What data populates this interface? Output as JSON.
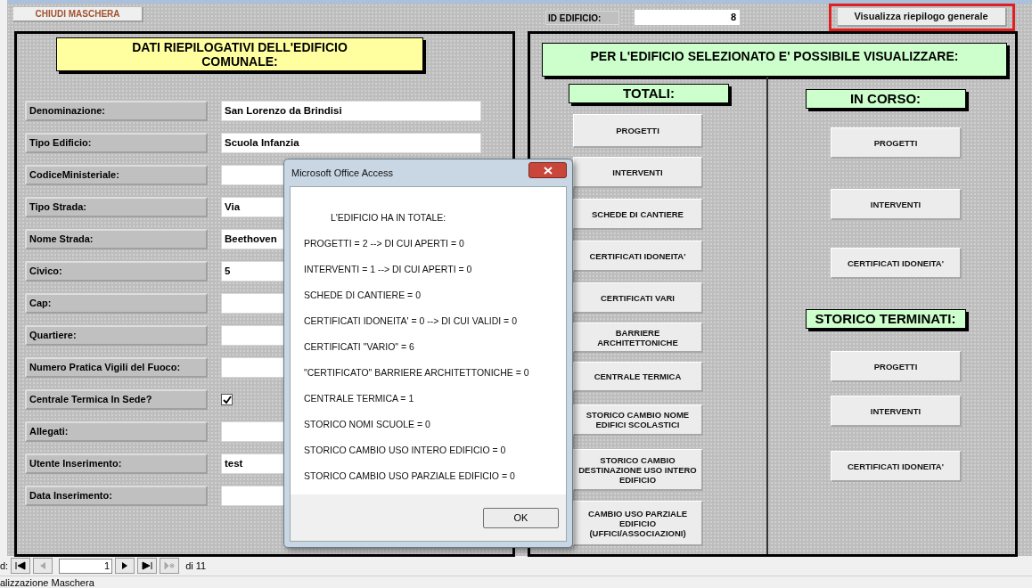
{
  "top_bar": {
    "close_button": "CHIUDI MASCHERA",
    "id_label": "ID EDIFICIO:",
    "id_value": "8",
    "summary_button": {
      "label": "Visualizza riepilogo generale",
      "highlighted": true
    }
  },
  "left_panel": {
    "title": "DATI RIEPILOGATIVI DELL'EDIFICIO COMUNALE:",
    "fields": [
      {
        "label": "Denominazione:",
        "kind": "text",
        "value": "San Lorenzo da Brindisi"
      },
      {
        "label": "Tipo Edificio:",
        "kind": "text",
        "value": "Scuola Infanzia"
      },
      {
        "label": "CodiceMinisteriale:",
        "kind": "text"
      },
      {
        "label": "Tipo Strada:",
        "kind": "text",
        "value": "Via"
      },
      {
        "label": "Nome Strada:",
        "kind": "text",
        "value": "Beethoven"
      },
      {
        "label": "Civico:",
        "kind": "text",
        "value": "5"
      },
      {
        "label": "Cap:",
        "kind": "text"
      },
      {
        "label": "Quartiere:",
        "kind": "text"
      },
      {
        "label": "Numero Pratica Vigili del Fuoco:",
        "kind": "text"
      },
      {
        "label": "Centrale Termica In Sede?",
        "kind": "checkbox",
        "checked": true
      },
      {
        "label": "Allegati:",
        "kind": "text"
      },
      {
        "label": "Utente Inserimento:",
        "kind": "text",
        "value": "test"
      },
      {
        "label": "Data Inserimento:",
        "kind": "text"
      }
    ]
  },
  "right_panel": {
    "title": "PER L'EDIFICIO SELEZIONATO E' POSSIBILE VISUALIZZARE:",
    "totali": {
      "header": "TOTALI:",
      "buttons": [
        "PROGETTI",
        "INTERVENTI",
        "SCHEDE DI CANTIERE",
        "CERTIFICATI IDONEITA'",
        "CERTIFICATI VARI",
        "BARRIERE ARCHITETTONICHE",
        "CENTRALE TERMICA",
        "STORICO CAMBIO NOME EDIFICI SCOLASTICI",
        "STORICO CAMBIO DESTINAZIONE USO INTERO EDIFICIO",
        "CAMBIO USO PARZIALE EDIFICIO (UFFICI/ASSOCIAZIONI)"
      ]
    },
    "side": [
      {
        "kind": "header",
        "text": "IN CORSO:"
      },
      {
        "kind": "button",
        "text": "PROGETTI"
      },
      {
        "kind": "button",
        "text": "INTERVENTI"
      },
      {
        "kind": "button",
        "text": "CERTIFICATI IDONEITA'"
      },
      {
        "kind": "header",
        "text": "STORICO TERMINATI:"
      },
      {
        "kind": "button",
        "text": "PROGETTI"
      },
      {
        "kind": "button",
        "text": "INTERVENTI"
      },
      {
        "kind": "button",
        "text": "CERTIFICATI IDONEITA'"
      }
    ]
  },
  "dialog": {
    "title": "Microsoft Office Access",
    "heading": "L'EDIFICIO HA IN TOTALE:",
    "lines": [
      "PROGETTI = 2 --> DI CUI APERTI = 0",
      "INTERVENTI = 1 --> DI CUI APERTI = 0",
      "SCHEDE DI CANTIERE = 0",
      "CERTIFICATI IDONEITA' = 0 --> DI CUI VALIDI = 0",
      "CERTIFICATI \"VARIO\" = 6",
      "\"CERTIFICATO\" BARRIERE ARCHITETTONICHE = 0",
      "CENTRALE TERMICA = 1",
      "STORICO NOMI SCUOLE = 0",
      "STORICO CAMBIO USO INTERO EDIFICIO = 0",
      "STORICO CAMBIO USO PARZIALE EDIFICIO = 0"
    ],
    "ok_button": "OK"
  },
  "navigator": {
    "label": "d:",
    "current": "1",
    "total": "di 11"
  },
  "status_bar": {
    "text": "alizzazione Maschera"
  }
}
